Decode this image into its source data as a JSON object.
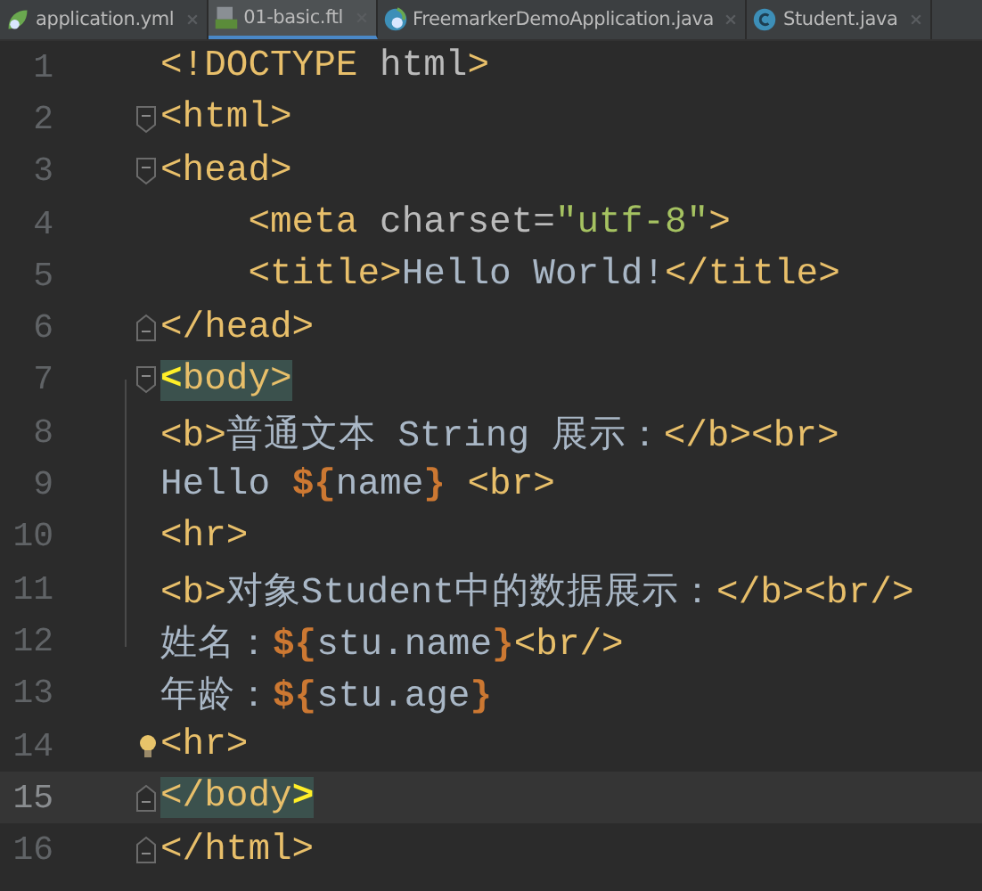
{
  "tabs": [
    {
      "label": "application.yml",
      "kind": "leaf",
      "selected": false
    },
    {
      "label": "01-basic.ftl",
      "kind": "template",
      "selected": true
    },
    {
      "label": "FreemarkerDemoApplication.java",
      "kind": "app",
      "selected": false
    },
    {
      "label": "Student.java",
      "kind": "class",
      "selected": false
    }
  ],
  "lines": [
    {
      "number": "1",
      "current": false,
      "fold_open": false,
      "fold_close": false,
      "bulb": false,
      "tokens": [
        {
          "text": "<!DOCTYPE ",
          "kind": "tag",
          "matched": false
        },
        {
          "text": "html",
          "kind": "attr",
          "matched": false
        },
        {
          "text": ">",
          "kind": "tag",
          "matched": false
        }
      ]
    },
    {
      "number": "2",
      "current": false,
      "fold_open": true,
      "fold_close": false,
      "bulb": false,
      "tokens": [
        {
          "text": "<html>",
          "kind": "tag",
          "matched": false
        }
      ]
    },
    {
      "number": "3",
      "current": false,
      "fold_open": true,
      "fold_close": false,
      "bulb": false,
      "tokens": [
        {
          "text": "<head>",
          "kind": "tag",
          "matched": false
        }
      ]
    },
    {
      "number": "4",
      "current": false,
      "fold_open": false,
      "fold_close": false,
      "bulb": false,
      "tokens": [
        {
          "text": "    <meta ",
          "kind": "tag",
          "matched": false
        },
        {
          "text": "charset=",
          "kind": "attr",
          "matched": false
        },
        {
          "text": "\"utf-8\"",
          "kind": "str",
          "matched": false
        },
        {
          "text": ">",
          "kind": "tag",
          "matched": false
        }
      ]
    },
    {
      "number": "5",
      "current": false,
      "fold_open": false,
      "fold_close": false,
      "bulb": false,
      "tokens": [
        {
          "text": "    <title>",
          "kind": "tag",
          "matched": false
        },
        {
          "text": "Hello World!",
          "kind": "text",
          "matched": false
        },
        {
          "text": "</title>",
          "kind": "tag",
          "matched": false
        }
      ]
    },
    {
      "number": "6",
      "current": false,
      "fold_open": false,
      "fold_close": true,
      "bulb": false,
      "tokens": [
        {
          "text": "</head>",
          "kind": "tag",
          "matched": false
        }
      ]
    },
    {
      "number": "7",
      "current": false,
      "fold_open": true,
      "fold_close": false,
      "bulb": false,
      "tokens": [
        {
          "text": "<",
          "kind": "brace",
          "matched": true
        },
        {
          "text": "body>",
          "kind": "tag",
          "matched": true
        }
      ]
    },
    {
      "number": "8",
      "current": false,
      "fold_open": false,
      "fold_close": false,
      "bulb": false,
      "tokens": [
        {
          "text": "<b>",
          "kind": "tag",
          "matched": false
        },
        {
          "text": "普通文本 String 展示：",
          "kind": "text",
          "matched": false
        },
        {
          "text": "</b><br>",
          "kind": "tag",
          "matched": false
        }
      ]
    },
    {
      "number": "9",
      "current": false,
      "fold_open": false,
      "fold_close": false,
      "bulb": false,
      "tokens": [
        {
          "text": "Hello ",
          "kind": "text",
          "matched": false
        },
        {
          "text": "${",
          "kind": "ftl",
          "matched": false
        },
        {
          "text": "name",
          "kind": "text",
          "matched": false
        },
        {
          "text": "}",
          "kind": "ftl",
          "matched": false
        },
        {
          "text": " <br>",
          "kind": "tag",
          "matched": false
        }
      ]
    },
    {
      "number": "10",
      "current": false,
      "fold_open": false,
      "fold_close": false,
      "bulb": false,
      "tokens": [
        {
          "text": "<hr>",
          "kind": "tag",
          "matched": false
        }
      ]
    },
    {
      "number": "11",
      "current": false,
      "fold_open": false,
      "fold_close": false,
      "bulb": false,
      "tokens": [
        {
          "text": "<b>",
          "kind": "tag",
          "matched": false
        },
        {
          "text": "对象Student中的数据展示：",
          "kind": "text",
          "matched": false
        },
        {
          "text": "</b><br/>",
          "kind": "tag",
          "matched": false
        }
      ]
    },
    {
      "number": "12",
      "current": false,
      "fold_open": false,
      "fold_close": false,
      "bulb": false,
      "tokens": [
        {
          "text": "姓名：",
          "kind": "text",
          "matched": false
        },
        {
          "text": "${",
          "kind": "ftl",
          "matched": false
        },
        {
          "text": "stu.name",
          "kind": "text",
          "matched": false
        },
        {
          "text": "}",
          "kind": "ftl",
          "matched": false
        },
        {
          "text": "<br/>",
          "kind": "tag",
          "matched": false
        }
      ]
    },
    {
      "number": "13",
      "current": false,
      "fold_open": false,
      "fold_close": false,
      "bulb": false,
      "tokens": [
        {
          "text": "年龄：",
          "kind": "text",
          "matched": false
        },
        {
          "text": "${",
          "kind": "ftl",
          "matched": false
        },
        {
          "text": "stu.age",
          "kind": "text",
          "matched": false
        },
        {
          "text": "}",
          "kind": "ftl",
          "matched": false
        }
      ]
    },
    {
      "number": "14",
      "current": false,
      "fold_open": false,
      "fold_close": false,
      "bulb": true,
      "tokens": [
        {
          "text": "<hr>",
          "kind": "tag",
          "matched": false
        }
      ]
    },
    {
      "number": "15",
      "current": true,
      "fold_open": false,
      "fold_close": true,
      "bulb": false,
      "tokens": [
        {
          "text": "</body",
          "kind": "tag",
          "matched": true
        },
        {
          "text": ">",
          "kind": "brace",
          "matched": true
        }
      ]
    },
    {
      "number": "16",
      "current": false,
      "fold_open": false,
      "fold_close": true,
      "bulb": false,
      "tokens": [
        {
          "text": "</html>",
          "kind": "tag",
          "matched": false
        }
      ]
    }
  ]
}
